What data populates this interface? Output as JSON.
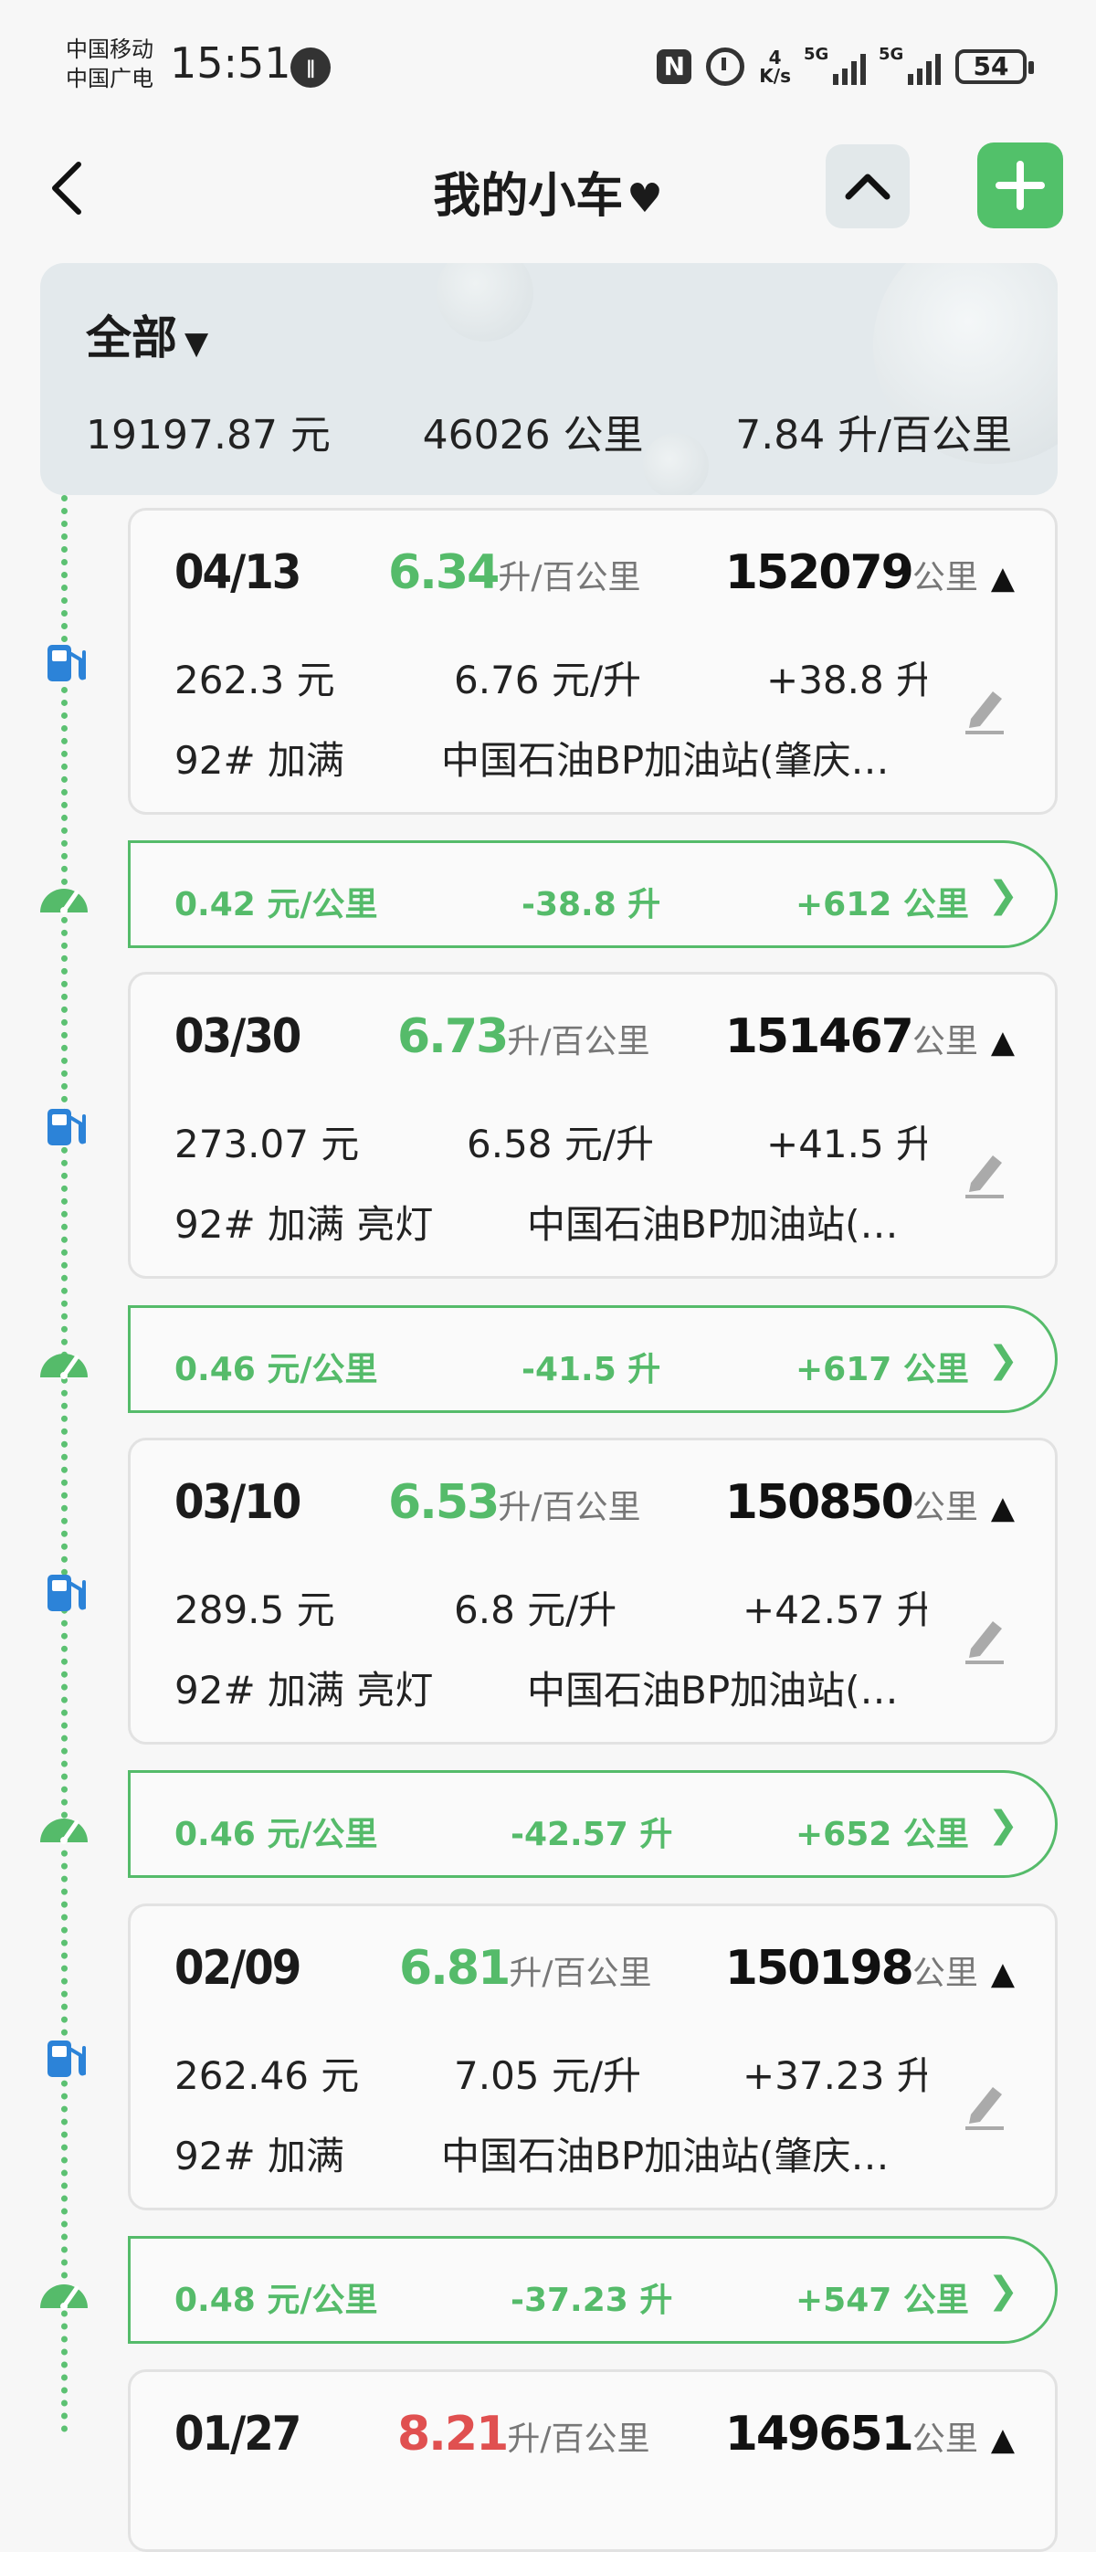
{
  "status_bar": {
    "carrier_1": "中国移动",
    "carrier_2": "中国广电",
    "time": "15:51",
    "net_speed_value": "4",
    "net_speed_unit": "K/s",
    "sig1_label": "5G",
    "sig2_label": "5G",
    "battery": "54"
  },
  "header": {
    "title": "我的小车",
    "title_icon": "heart-icon",
    "collapse_icon": "chevron-up-icon",
    "add_icon": "plus-icon"
  },
  "summary": {
    "filter": "全部",
    "total_cost": "19197.87 元",
    "total_distance": "46026 公里",
    "avg_consumption": "7.84 升/百公里"
  },
  "records": [
    {
      "date": "04/13",
      "consumption": "6.34",
      "cons_unit": "升/百公里",
      "odometer": "152079",
      "odo_unit": "公里",
      "cost": "262.3 元",
      "price": "6.76 元/升",
      "volume": "+38.8 升",
      "fuel": "92# 加满",
      "station": "中国石油BP加油站(肇庆…",
      "summary": {
        "cost_per_km": "0.42 元/公里",
        "volume_delta": "-38.8 升",
        "distance": "+612 公里"
      }
    },
    {
      "date": "03/30",
      "consumption": "6.73",
      "cons_unit": "升/百公里",
      "odometer": "151467",
      "odo_unit": "公里",
      "cost": "273.07 元",
      "price": "6.58 元/升",
      "volume": "+41.5 升",
      "fuel": "92# 加满 亮灯",
      "station": "中国石油BP加油站(…",
      "summary": {
        "cost_per_km": "0.46 元/公里",
        "volume_delta": "-41.5 升",
        "distance": "+617 公里"
      }
    },
    {
      "date": "03/10",
      "consumption": "6.53",
      "cons_unit": "升/百公里",
      "odometer": "150850",
      "odo_unit": "公里",
      "cost": "289.5 元",
      "price": "6.8 元/升",
      "volume": "+42.57 升",
      "fuel": "92# 加满 亮灯",
      "station": "中国石油BP加油站(…",
      "summary": {
        "cost_per_km": "0.46 元/公里",
        "volume_delta": "-42.57 升",
        "distance": "+652 公里"
      }
    },
    {
      "date": "02/09",
      "consumption": "6.81",
      "cons_unit": "升/百公里",
      "odometer": "150198",
      "odo_unit": "公里",
      "cost": "262.46 元",
      "price": "7.05 元/升",
      "volume": "+37.23 升",
      "fuel": "92# 加满",
      "station": "中国石油BP加油站(肇庆…",
      "summary": {
        "cost_per_km": "0.48 元/公里",
        "volume_delta": "-37.23 升",
        "distance": "+547 公里"
      }
    },
    {
      "date": "01/27",
      "consumption": "8.21",
      "cons_unit": "升/百公里",
      "odometer": "149651",
      "odo_unit": "公里"
    }
  ],
  "colors": {
    "accent": "#55bb6a",
    "warn": "#e05050",
    "pump": "#2c83d8"
  }
}
